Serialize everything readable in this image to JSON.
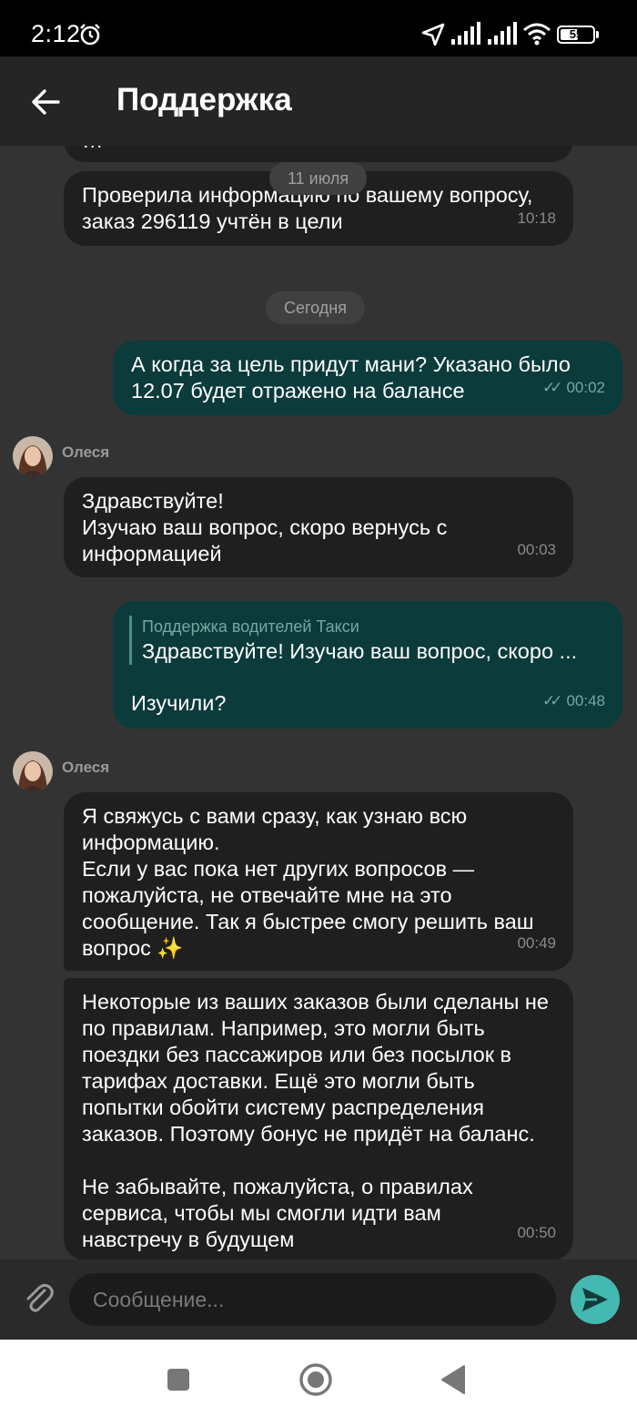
{
  "status_bar": {
    "time": "2:12",
    "battery": "55",
    "battery_fraction": 0.55,
    "icons": [
      "alarm-icon",
      "location-arrow-icon",
      "signal-icon",
      "signal-icon",
      "wifi-icon",
      "battery-icon"
    ]
  },
  "header": {
    "title": "Поддержка",
    "back_icon": "arrow-left-icon"
  },
  "chat": {
    "partial_top_text": "…",
    "date_1": "11 июля",
    "msg_1": {
      "text": "Проверила информацию по вашему вопросу,\nзаказ 296119 учтён в цели",
      "time": "10:18"
    },
    "date_2": "Сегодня",
    "msg_2": {
      "text": "А когда за цель придут мани? Указано было\n12.07 будет отражено на балансе",
      "time": "00:02",
      "status": "✓✓"
    },
    "sender_1": "Олеся",
    "msg_3": {
      "text": "Здравствуйте!\nИзучаю ваш вопрос, скоро вернусь с\nинформацией",
      "time": "00:03"
    },
    "msg_4": {
      "quote_author": "Поддержка водителей Такси",
      "quote_text": "Здравствуйте! Изучаю ваш вопрос, скоро ...",
      "text": "Изучили?",
      "time": "00:48",
      "status": "✓✓"
    },
    "sender_2": "Олеся",
    "msg_5": {
      "text": "Я свяжусь с вами сразу, как узнаю всю\nинформацию.\nЕсли у вас пока нет других вопросов —\nпожалуйста, не отвечайте мне на это\nсообщение. Так я быстрее смогу решить ваш\nвопрос ✨",
      "time": "00:49"
    },
    "msg_6": {
      "text": "Некоторые из ваших заказов были сделаны не\nпо правилам. Например, это могли быть\nпоездки без пассажиров или без посылок в\nтарифах доставки. Ещё это могли быть\nпопытки обойти систему распределения\nзаказов. Поэтому бонус не придёт на баланс.\n\nНе забывайте, пожалуйста, о правилах\nсервиса, чтобы мы смогли идти вам\nнавстречу в будущем",
      "time": "00:50"
    }
  },
  "composer": {
    "placeholder": "Сообщение...",
    "attach_icon": "paperclip-icon",
    "send_icon": "send-icon"
  },
  "nav": {
    "icons": [
      "square-icon",
      "circle-home-icon",
      "triangle-back-icon"
    ]
  },
  "colors": {
    "background": "#333333",
    "incoming": "#1f1f1f",
    "outgoing": "#0b3b3a",
    "accent": "#44b9b2"
  }
}
